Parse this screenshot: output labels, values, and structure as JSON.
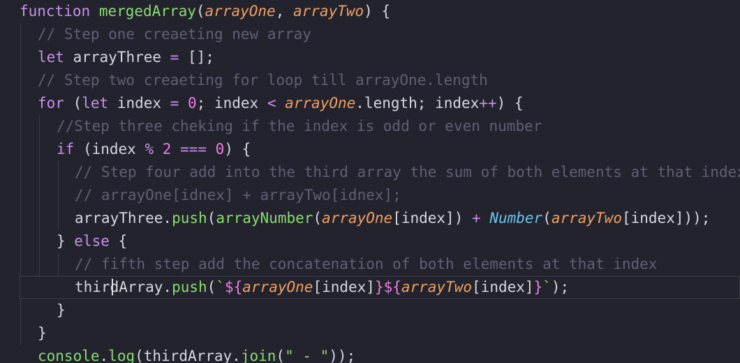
{
  "editor": {
    "language": "javascript",
    "colors": {
      "background": "#23232e",
      "keyword": "#c792ea",
      "function": "#89dd70",
      "parameter": "#f0a060",
      "comment": "#5e6175",
      "number": "#f07de0",
      "builtin": "#6ac4e8",
      "string": "#9bd872",
      "text": "#d6d7e0"
    },
    "active_line_index": 12,
    "lines": [
      [
        [
          "kw",
          "function"
        ],
        [
          "pl",
          " "
        ],
        [
          "fn",
          "mergedArray"
        ],
        [
          "pun",
          "("
        ],
        [
          "par",
          "arrayOne"
        ],
        [
          "pun",
          ", "
        ],
        [
          "par",
          "arrayTwo"
        ],
        [
          "pun",
          ") {"
        ]
      ],
      [
        [
          "cm",
          "// Step one creaeting new array"
        ]
      ],
      [
        [
          "kw",
          "let"
        ],
        [
          "pl",
          " arrayThree "
        ],
        [
          "op",
          "="
        ],
        [
          "pun",
          " [];"
        ]
      ],
      [
        [
          "cm",
          "// Step two creaeting for loop till arrayOne.length"
        ]
      ],
      [
        [
          "kw",
          "for"
        ],
        [
          "pun",
          " ("
        ],
        [
          "kw",
          "let"
        ],
        [
          "pl",
          " index "
        ],
        [
          "op",
          "="
        ],
        [
          "pl",
          " "
        ],
        [
          "num",
          "0"
        ],
        [
          "pun",
          "; index "
        ],
        [
          "op",
          "<"
        ],
        [
          "pl",
          " "
        ],
        [
          "par",
          "arrayOne"
        ],
        [
          "pun",
          ".length; index"
        ],
        [
          "op",
          "++"
        ],
        [
          "pun",
          ") {"
        ]
      ],
      [
        [
          "cm",
          "//Step three cheking if the index is odd or even number"
        ]
      ],
      [
        [
          "kw",
          "if"
        ],
        [
          "pun",
          " (index "
        ],
        [
          "op",
          "%"
        ],
        [
          "pl",
          " "
        ],
        [
          "num",
          "2"
        ],
        [
          "pl",
          " "
        ],
        [
          "op",
          "==="
        ],
        [
          "pl",
          " "
        ],
        [
          "num",
          "0"
        ],
        [
          "pun",
          ") {"
        ]
      ],
      [
        [
          "cm",
          "// Step four add into the third array the sum of both elements at that index"
        ]
      ],
      [
        [
          "cm",
          "// arrayOne[idnex] + arrayTwo[idnex];"
        ]
      ],
      [
        [
          "pl",
          "arrayThree."
        ],
        [
          "fn",
          "push"
        ],
        [
          "pun",
          "("
        ],
        [
          "fn",
          "arrayNumber"
        ],
        [
          "pun",
          "("
        ],
        [
          "par",
          "arrayOne"
        ],
        [
          "pun",
          "[index]) "
        ],
        [
          "op",
          "+"
        ],
        [
          "pl",
          " "
        ],
        [
          "bi",
          "Number"
        ],
        [
          "pun",
          "("
        ],
        [
          "par",
          "arrayTwo"
        ],
        [
          "pun",
          "[index]));"
        ]
      ],
      [
        [
          "pun",
          "} "
        ],
        [
          "kw",
          "else"
        ],
        [
          "pun",
          " {"
        ]
      ],
      [
        [
          "cm",
          "// fifth step add the concatenation of both elements at that index"
        ]
      ],
      [
        [
          "pl",
          "thirdArray."
        ],
        [
          "fn",
          "push"
        ],
        [
          "pun",
          "("
        ],
        [
          "str",
          "`"
        ],
        [
          "tpl",
          "${"
        ],
        [
          "par",
          "arrayOne"
        ],
        [
          "pun",
          "[index]"
        ],
        [
          "tpl",
          "}${"
        ],
        [
          "par",
          "arrayTwo"
        ],
        [
          "pun",
          "[index]"
        ],
        [
          "tpl",
          "}"
        ],
        [
          "str",
          "`"
        ],
        [
          "pun",
          ");"
        ]
      ],
      [
        [
          "pun",
          "}"
        ]
      ],
      [
        [
          "pun",
          "}"
        ]
      ],
      [
        [
          "fn",
          "console"
        ],
        [
          "pun",
          "."
        ],
        [
          "fn",
          "log"
        ],
        [
          "pun",
          "(thirdArray."
        ],
        [
          "fn",
          "join"
        ],
        [
          "pun",
          "("
        ],
        [
          "str",
          "\" - \""
        ],
        [
          "pun",
          "));"
        ]
      ]
    ]
  }
}
